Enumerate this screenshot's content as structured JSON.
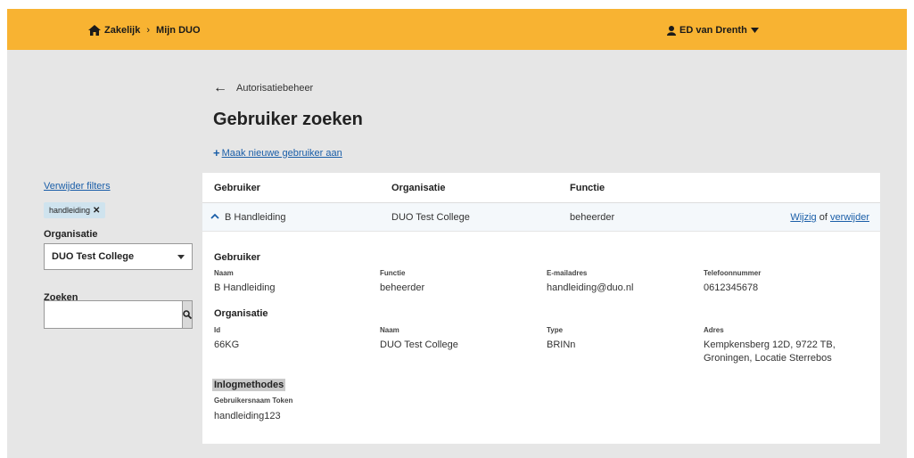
{
  "header": {
    "breadcrumb": [
      "Zakelijk",
      "Mijn DUO"
    ],
    "breadcrumb_separator": "›",
    "user_name": "ED van Drenth",
    "icons": {
      "home": "home-icon",
      "user": "user-icon",
      "dropdown": "caret-down-icon"
    },
    "bar_color": "#f8b332"
  },
  "page": {
    "back_label": "Autorisatiebeheer",
    "title": "Gebruiker zoeken",
    "new_user_label": "Maak nieuwe gebruiker aan"
  },
  "filters": {
    "remove_label": "Verwijder filters",
    "chip": "handleiding",
    "org_label": "Organisatie",
    "org_selected": "DUO Test College",
    "search_label": "Zoeken",
    "search_value": ""
  },
  "table": {
    "headers": [
      "Gebruiker",
      "Organisatie",
      "Functie"
    ],
    "row": {
      "user": "B Handleiding",
      "org": "DUO Test College",
      "function": "beheerder",
      "edit_label": "Wijzig",
      "or_label": "of",
      "delete_label": "verwijder"
    }
  },
  "details": {
    "user_section": "Gebruiker",
    "user": {
      "name_label": "Naam",
      "name": "B Handleiding",
      "function_label": "Functie",
      "function": "beheerder",
      "email_label": "E-mailadres",
      "email": "handleiding@duo.nl",
      "phone_label": "Telefoonnummer",
      "phone": "0612345678"
    },
    "org_section": "Organisatie",
    "org": {
      "id_label": "Id",
      "id": "66KG",
      "name_label": "Naam",
      "name": "DUO Test College",
      "type_label": "Type",
      "type": "BRINn",
      "address_label": "Adres",
      "address_line1": "Kempkensberg 12D, 9722 TB,",
      "address_line2": "Groningen, Locatie Sterrebos"
    },
    "login_section": "Inlogmethodes",
    "login": {
      "token_label": "Gebruikersnaam Token",
      "token": "handleiding123"
    }
  }
}
